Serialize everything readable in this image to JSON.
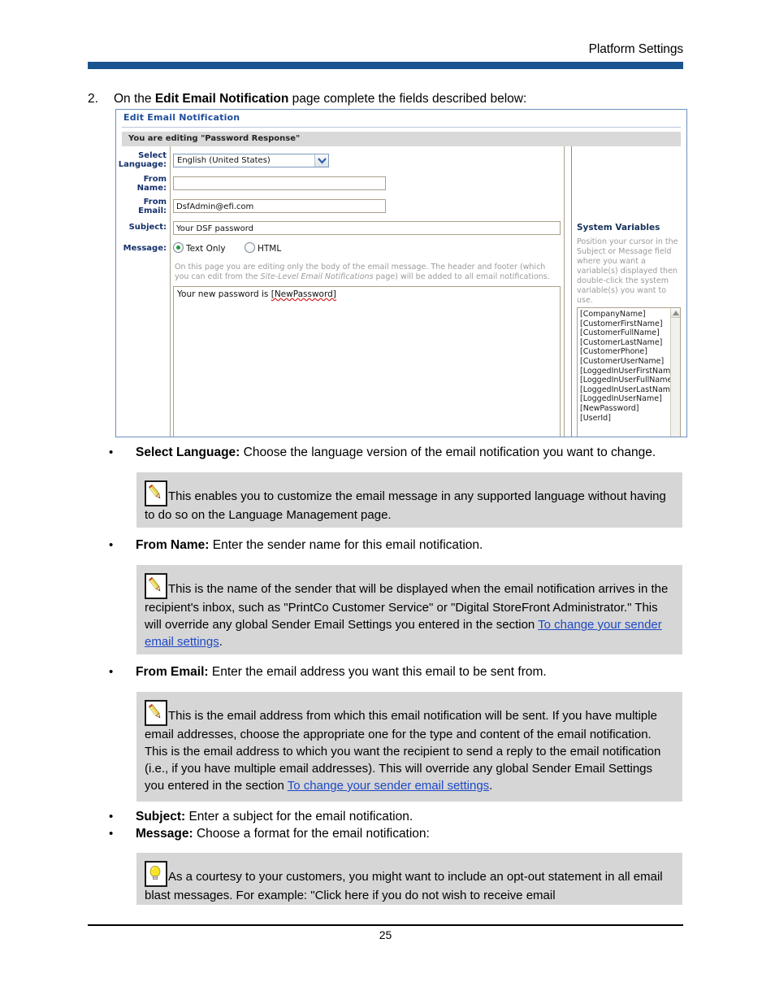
{
  "header": {
    "title": "Platform Settings",
    "accent_color": "#1a5490"
  },
  "step": {
    "number": "2.",
    "prefix": "On the ",
    "bold": "Edit Email Notification",
    "suffix": " page complete the fields described below:"
  },
  "screenshot": {
    "panel_title": "Edit Email Notification",
    "subheader": "You are editing \"Password Response\"",
    "fields": {
      "select_language_label": "Select Language:",
      "select_language_value": "English (United States)",
      "from_name_label": "From Name:",
      "from_name_value": "",
      "from_email_label": "From Email:",
      "from_email_value": "DsfAdmin@efi.com",
      "subject_label": "Subject:",
      "subject_value": "Your DSF password",
      "message_label": "Message:"
    },
    "radios": [
      {
        "label": "Text Only",
        "selected": true
      },
      {
        "label": "HTML",
        "selected": false
      }
    ],
    "message_hint_1": "On this page you are editing only the body of the email message. The header and footer (which you can edit from the ",
    "message_hint_italic": "Site-Level Email Notifications",
    "message_hint_2": " page) will be added to all email notifications.",
    "message_body_prefix": "Your new password is ",
    "message_body_variable": "[NewPassword]",
    "system_variables": {
      "title": "System Variables",
      "description": "Position your cursor in the Subject or Message field where you want a variable(s) displayed then double-click the system variable(s) you want to use.",
      "items": [
        "[CompanyName]",
        "[CustomerFirstName]",
        "[CustomerFullName]",
        "[CustomerLastName]",
        "[CustomerPhone]",
        "[CustomerUserName]",
        "[LoggedInUserFirstName]",
        "[LoggedInUserFullName]",
        "[LoggedInUserLastName]",
        "[LoggedInUserName]",
        "[NewPassword]",
        "[UserId]"
      ]
    }
  },
  "bullets": [
    {
      "term": "Select Language:",
      "text": " Choose the language version of the email notification you want to change."
    },
    {
      "term": "From Name:",
      "text": " Enter the sender name for this email notification."
    },
    {
      "term": "From Email:",
      "text": " Enter the email address you want this email to be sent from."
    },
    {
      "term": "Subject:",
      "text": " Enter a subject for the email notification."
    },
    {
      "term": "Message:",
      "text": " Choose a format for the email notification:"
    }
  ],
  "notes": {
    "language": {
      "icon": "note-pencil-icon",
      "text": "This enables you to customize the email message in any supported language without having to do so on the Language Management page."
    },
    "from_name": {
      "icon": "note-pencil-icon",
      "text_1": "This is the name of the sender that will be displayed when the email notification arrives in the recipient's inbox, such as \"PrintCo Customer Service\" or \"Digital StoreFront Administrator.\" This will override any global Sender Email Settings you entered in the section ",
      "link": "To change your sender email settings",
      "text_2": "."
    },
    "from_email": {
      "icon": "note-pencil-icon",
      "text_1": "This is the email address from which this email notification will be sent. If you have multiple email addresses, choose the appropriate one for the type and content of the email notification. This is the email address to which you want the recipient to send a reply to the email notification (i.e., if you have multiple email addresses). This will override any global Sender Email Settings you entered in the section ",
      "link": "To change your sender email settings",
      "text_2": "."
    },
    "message": {
      "icon": "tip-lightbulb-icon",
      "text": "As a courtesy to your customers, you might want to include an opt-out statement in all email blast messages. For example: \"Click here if you do not wish to receive email"
    }
  },
  "footer": {
    "page_number": "25"
  }
}
